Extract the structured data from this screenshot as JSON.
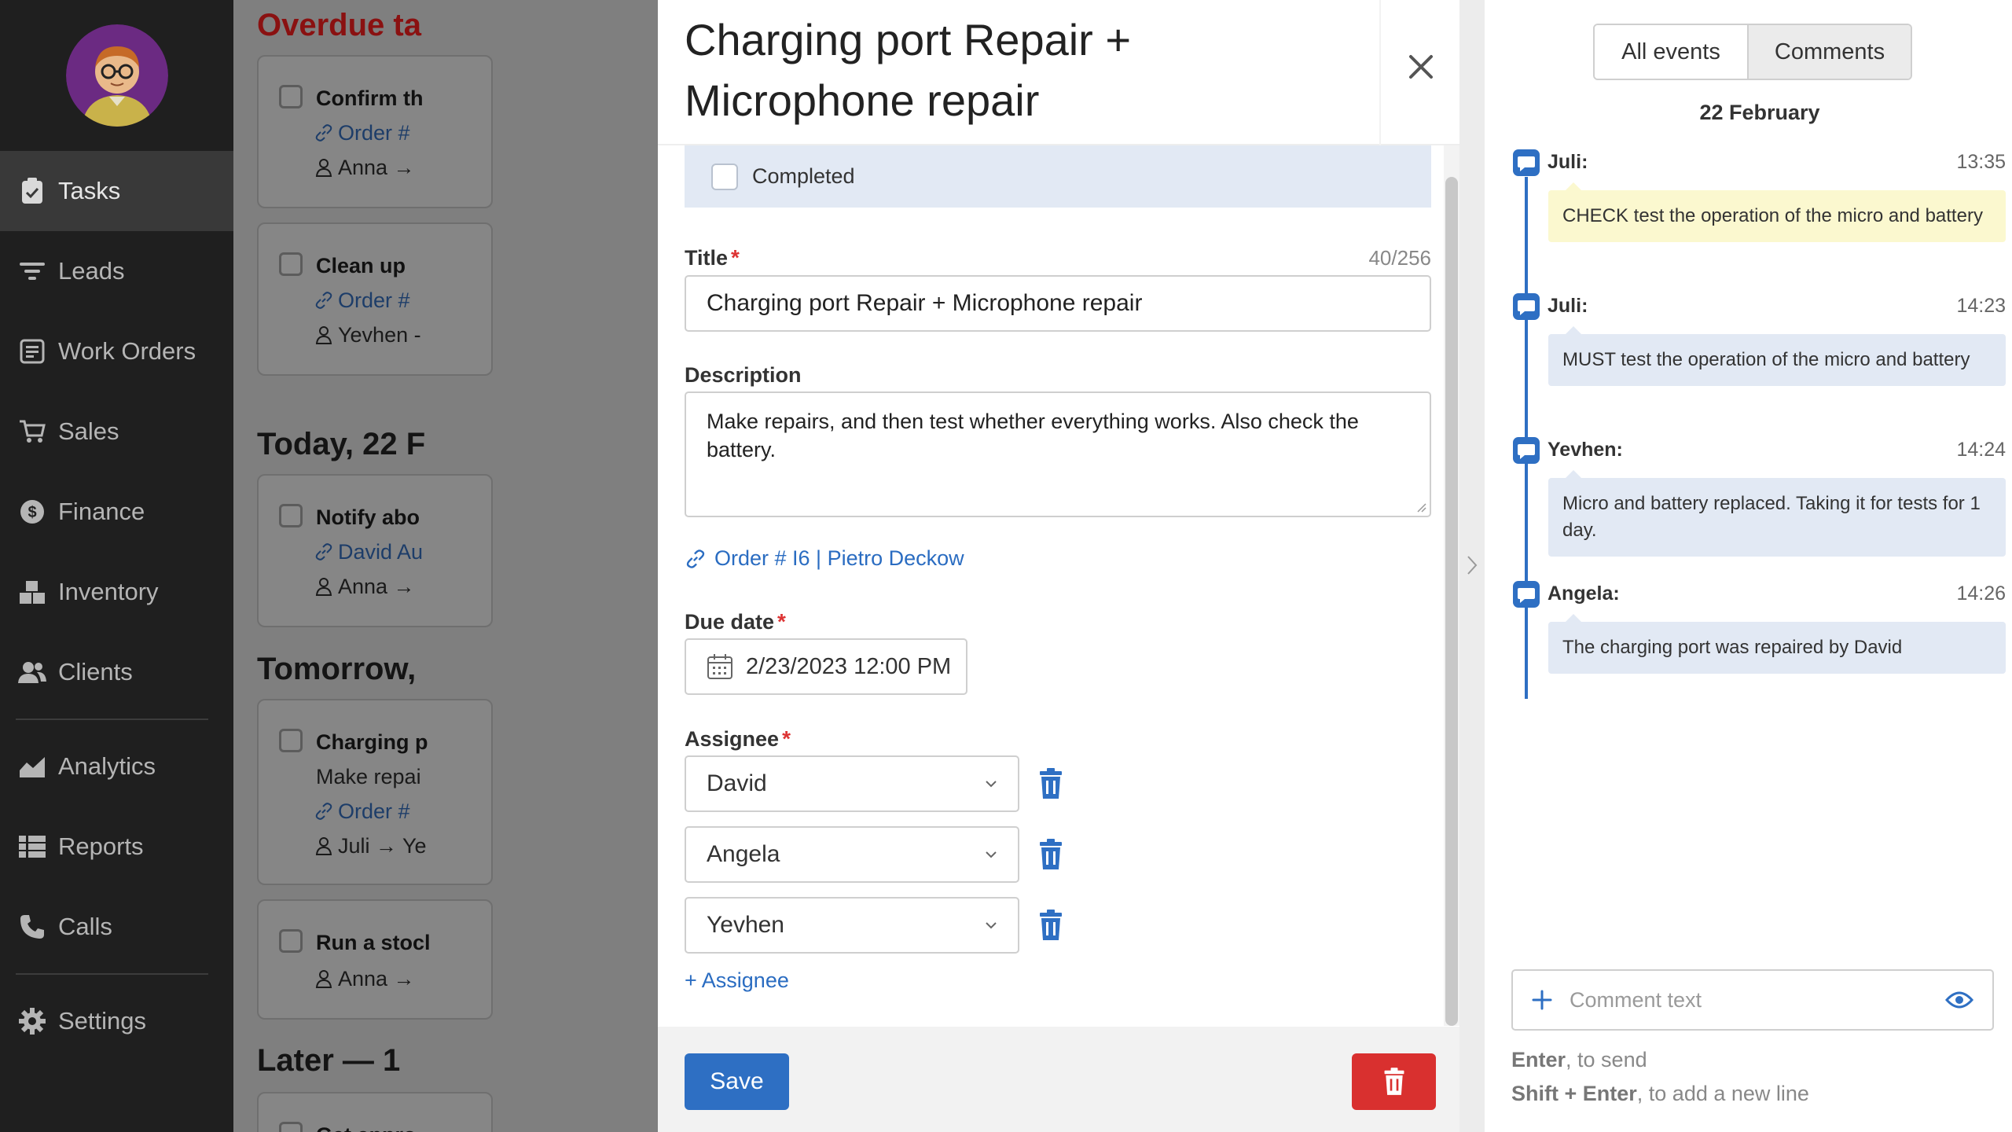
{
  "sidebar": {
    "items": [
      {
        "label": "Tasks",
        "icon": "clipboard-icon"
      },
      {
        "label": "Leads",
        "icon": "filter-icon"
      },
      {
        "label": "Work Orders",
        "icon": "work-order-icon"
      },
      {
        "label": "Sales",
        "icon": "cart-icon"
      },
      {
        "label": "Finance",
        "icon": "dollar-icon"
      },
      {
        "label": "Inventory",
        "icon": "boxes-icon"
      },
      {
        "label": "Clients",
        "icon": "users-icon"
      },
      {
        "label": "Analytics",
        "icon": "chart-icon"
      },
      {
        "label": "Reports",
        "icon": "list-icon"
      },
      {
        "label": "Calls",
        "icon": "phone-icon"
      },
      {
        "label": "Settings",
        "icon": "gear-icon"
      }
    ]
  },
  "background": {
    "sections": [
      "Overdue ta",
      "Today, 22 F",
      "Tomorrow,",
      "Later — 1"
    ],
    "tasks": [
      {
        "title": "Confirm th",
        "link": "Order #",
        "person": "Anna →"
      },
      {
        "title": "Clean up",
        "link": "Order #",
        "person": "Yevhen -"
      },
      {
        "title": "Notify abo",
        "link": "David Au",
        "person": "Anna →"
      },
      {
        "title": "Charging p",
        "desc": "Make repai",
        "link": "Order #",
        "person": "Juli → Ye"
      },
      {
        "title": "Run a stocl",
        "person": "Anna →"
      },
      {
        "title": "Get appro"
      }
    ]
  },
  "modal": {
    "title": "Charging port Repair + Microphone repair",
    "completed_label": "Completed",
    "title_label": "Title",
    "title_count": "40/256",
    "title_value": "Charging port Repair + Microphone repair",
    "description_label": "Description",
    "description_value": "Make repairs, and then test whether everything works. Also check the battery.",
    "order_link": "Order # I6 | Pietro Deckow",
    "due_date_label": "Due date",
    "due_date_value": "2/23/2023 12:00 PM",
    "assignee_label": "Assignee",
    "assignees": [
      "David",
      "Angela",
      "Yevhen"
    ],
    "add_assignee": "+ Assignee",
    "save_label": "Save",
    "required_mark": "*"
  },
  "comments_panel": {
    "tabs": [
      "All events",
      "Comments"
    ],
    "active_tab": "Comments",
    "date": "22 February",
    "items": [
      {
        "author": "Juli:",
        "time": "13:35",
        "text": "CHECK test the operation of the micro and battery",
        "highlight": true
      },
      {
        "author": "Juli:",
        "time": "14:23",
        "text": "MUST test the operation of the micro and battery",
        "highlight": false
      },
      {
        "author": "Yevhen:",
        "time": "14:24",
        "text": "Micro and battery replaced. Taking it for tests for 1 day.",
        "highlight": false
      },
      {
        "author": "Angela:",
        "time": "14:26",
        "text": "The charging port was repaired by David",
        "highlight": false
      }
    ],
    "input_placeholder": "Comment text",
    "hint_enter_key": "Enter",
    "hint_enter_text": ", to send",
    "hint_shift_key": "Shift + Enter",
    "hint_shift_text": ", to add a new line"
  },
  "colors": {
    "accent": "#2e6fc3",
    "danger": "#d9302f",
    "sidebar_bg": "#1f1f1f",
    "highlight_comment": "#fbf8cf",
    "comment_bg": "#e2e9f4"
  }
}
